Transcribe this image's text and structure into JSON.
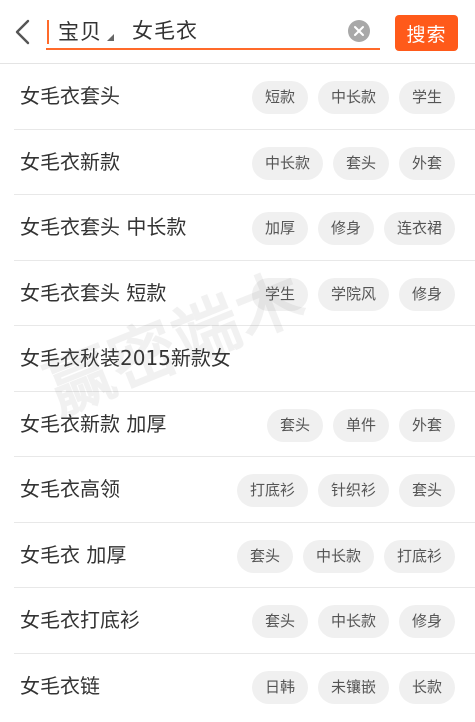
{
  "header": {
    "scope_label": "宝贝",
    "query": "女毛衣",
    "search_label": "搜索"
  },
  "colors": {
    "accent": "#ff5a1a",
    "tag_bg": "#f0f0f0"
  },
  "suggestions": [
    {
      "text": "女毛衣套头",
      "tags": [
        "短款",
        "中长款",
        "学生"
      ]
    },
    {
      "text": "女毛衣新款",
      "tags": [
        "中长款",
        "套头",
        "外套"
      ]
    },
    {
      "text": "女毛衣套头 中长款",
      "tags": [
        "加厚",
        "修身",
        "连衣裙"
      ]
    },
    {
      "text": "女毛衣套头 短款",
      "tags": [
        "学生",
        "学院风",
        "修身"
      ]
    },
    {
      "text": "女毛衣秋装2015新款女",
      "tags": []
    },
    {
      "text": "女毛衣新款 加厚",
      "tags": [
        "套头",
        "单件",
        "外套"
      ]
    },
    {
      "text": "女毛衣高领",
      "tags": [
        "打底衫",
        "针织衫",
        "套头"
      ]
    },
    {
      "text": "女毛衣 加厚",
      "tags": [
        "套头",
        "中长款",
        "打底衫"
      ]
    },
    {
      "text": "女毛衣打底衫",
      "tags": [
        "套头",
        "中长款",
        "修身"
      ]
    },
    {
      "text": "女毛衣链",
      "tags": [
        "日韩",
        "未镶嵌",
        "长款"
      ]
    }
  ],
  "watermark": "赢密端木"
}
